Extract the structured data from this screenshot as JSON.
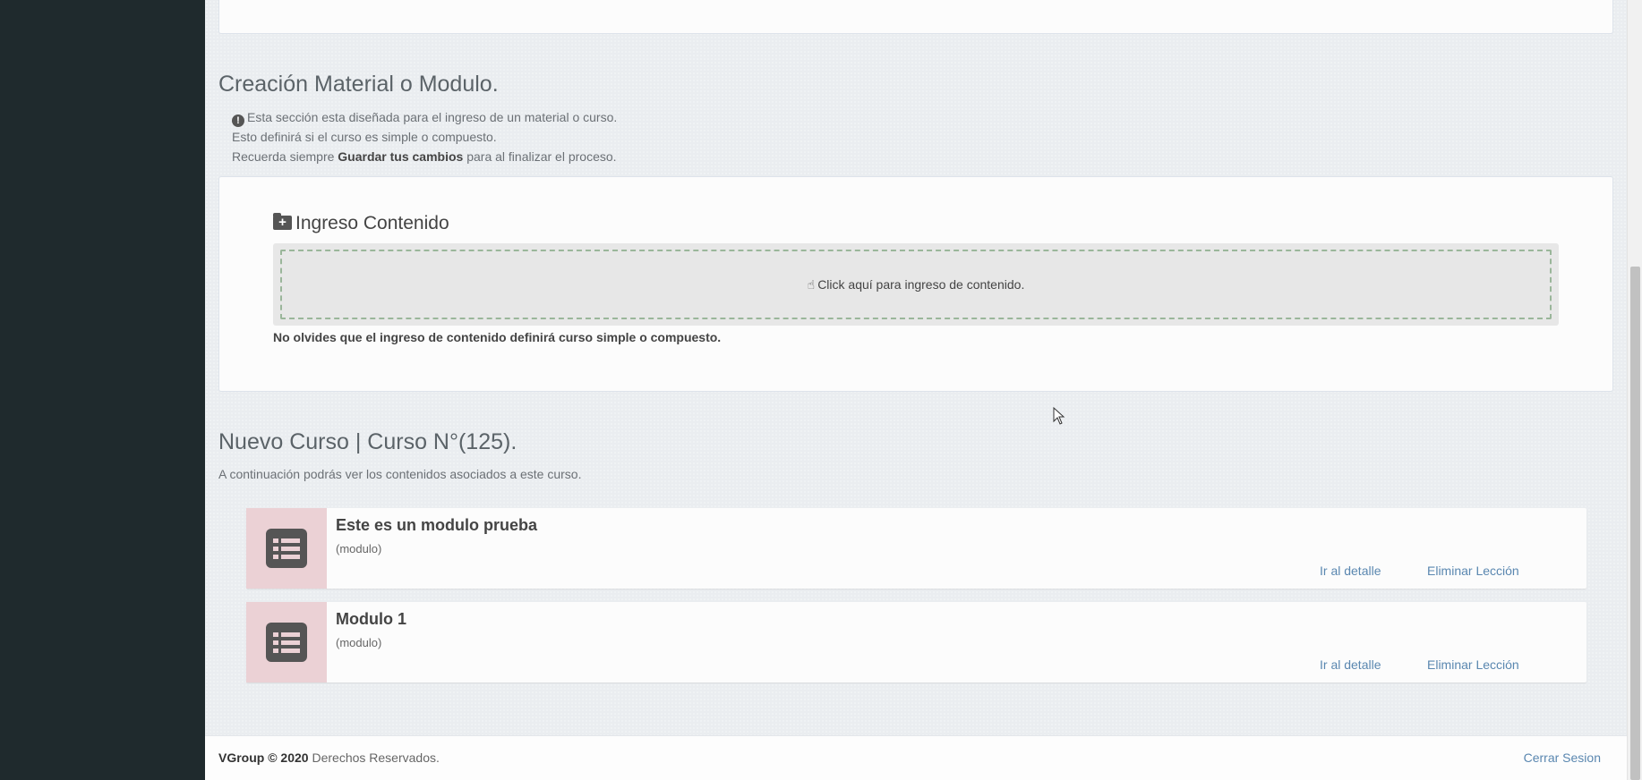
{
  "creation_section": {
    "title": "Creación Material o Modulo.",
    "info_line_1": "Esta sección esta diseñada para el ingreso de un material o curso.",
    "info_line_2": "Esto definirá si el curso es simple o compuesto.",
    "info_line_3_prefix": "Recuerda siempre ",
    "info_line_3_bold": "Guardar tus cambios",
    "info_line_3_suffix": " para al finalizar el proceso."
  },
  "content_card": {
    "heading": "Ingreso Contenido",
    "dropzone_label": "Click aquí para ingreso de contenido.",
    "note": "No olvides que el ingreso de contenido definirá curso simple o compuesto."
  },
  "course_section": {
    "title": "Nuevo Curso | Curso N°(125).",
    "description": "A continuación podrás ver los contenidos asociados a este curso.",
    "lessons": [
      {
        "title": "Este es un modulo prueba",
        "type": "(modulo)",
        "detail_link": "Ir al detalle",
        "delete_link": "Eliminar Lección"
      },
      {
        "title": "Modulo 1",
        "type": "(modulo)",
        "detail_link": "Ir al detalle",
        "delete_link": "Eliminar Lección"
      }
    ]
  },
  "footer": {
    "brand": "VGroup © 2020",
    "rights": " Derechos Reservados.",
    "logout": "Cerrar Sesion"
  },
  "colors": {
    "sidebar": "#1f2a2d",
    "link": "#5a87b0",
    "thumb": "#ebd1d5"
  }
}
